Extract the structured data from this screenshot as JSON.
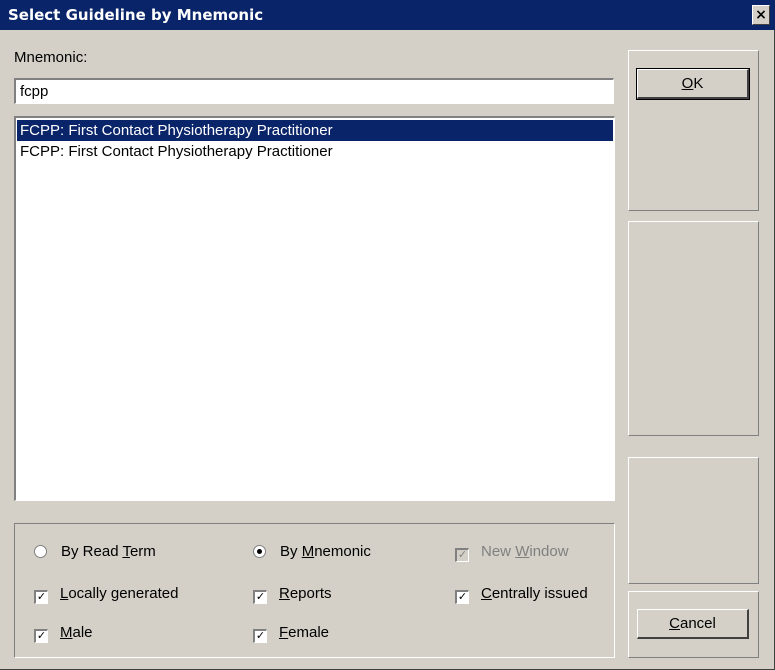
{
  "window": {
    "title": "Select Guideline by Mnemonic",
    "close_label": "×"
  },
  "mnemonic": {
    "label": "Mnemonic:",
    "value": "fcpp"
  },
  "results": [
    {
      "text": "FCPP: First Contact Physiotherapy Practitioner",
      "selected": true
    },
    {
      "text": "FCPP: First Contact Physiotherapy Practitioner",
      "selected": false
    }
  ],
  "options": {
    "by_read_term": {
      "label_pre": "By Read ",
      "accel": "T",
      "label_post": "erm",
      "checked": false
    },
    "by_mnemonic": {
      "label_pre": "By ",
      "accel": "M",
      "label_post": "nemonic",
      "checked": true
    },
    "new_window": {
      "label_pre": "New ",
      "accel": "W",
      "label_post": "indow",
      "checked": true,
      "disabled": true
    },
    "locally_generated": {
      "label_pre": "",
      "accel": "L",
      "label_post": "ocally generated",
      "checked": true
    },
    "reports": {
      "label_pre": "",
      "accel": "R",
      "label_post": "eports",
      "checked": true
    },
    "centrally_issued": {
      "label_pre": "",
      "accel": "C",
      "label_post": "entrally issued",
      "checked": true
    },
    "male": {
      "label_pre": "",
      "accel": "M",
      "label_post": "ale",
      "checked": true
    },
    "female": {
      "label_pre": "",
      "accel": "F",
      "label_post": "emale",
      "checked": true
    }
  },
  "buttons": {
    "ok": {
      "accel": "O",
      "rest": "K"
    },
    "cancel": {
      "accel": "C",
      "rest": "ancel"
    }
  },
  "check_mark": "✓"
}
